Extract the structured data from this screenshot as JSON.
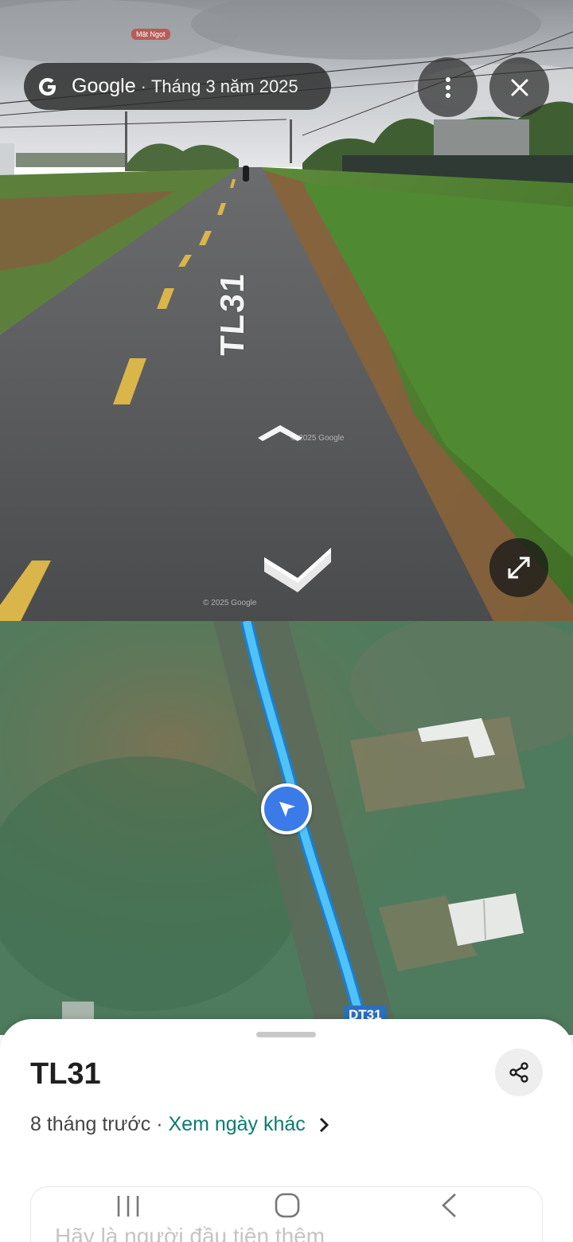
{
  "streetview": {
    "watermark": "Mật Ngọt",
    "brand": "Google",
    "separator": "·",
    "capture_date": "Tháng 3 năm 2025",
    "road_marking": "TL31",
    "copyright_1": "© 2025 Google",
    "copyright_2": "© 2025 Google",
    "icons": {
      "logo": "google-g-icon",
      "more": "more-vert-icon",
      "close": "close-icon",
      "expand": "expand-icon",
      "forward": "chevron-up-icon",
      "back": "chevron-down-icon"
    }
  },
  "map": {
    "route_label": "DT31",
    "route_color": "#4fc3f7",
    "marker_color": "#3b7be8"
  },
  "sheet": {
    "title": "TL31",
    "age": "8 tháng trước",
    "separator": " · ",
    "other_dates_link": "Xem ngày khác",
    "contribute_prompt": "Hãy là người đầu tiên thêm",
    "link_color": "#0b7a70"
  },
  "system_nav": {
    "icons": [
      "recent-apps-icon",
      "home-icon",
      "back-icon"
    ]
  }
}
